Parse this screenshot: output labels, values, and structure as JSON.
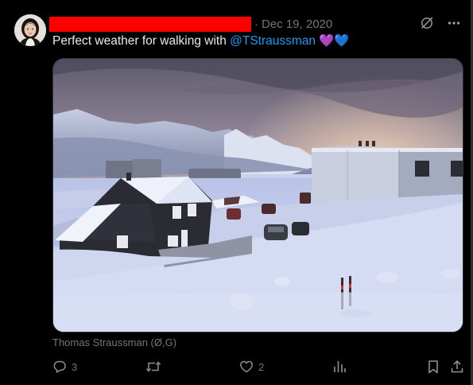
{
  "tweet": {
    "date": "Dec 19, 2020",
    "dot": "·",
    "text_prefix": "Perfect weather for walking with ",
    "mention": "@TStraussman",
    "emoji": "💜💙",
    "photo_credit": "Thomas Straussman (Ø,G)"
  },
  "actions": {
    "replies": "3",
    "retweets": "",
    "likes": "2"
  },
  "colors": {
    "background": "#000000",
    "text": "#e7e9ea",
    "muted": "#71767b",
    "link": "#1d9bf0",
    "redaction": "#ff0000"
  },
  "icons": {
    "grok": "grok-icon",
    "more": "more-icon",
    "reply": "reply-icon",
    "retweet": "retweet-icon",
    "like": "heart-icon",
    "views": "views-icon",
    "bookmark": "bookmark-icon",
    "share": "share-icon"
  }
}
